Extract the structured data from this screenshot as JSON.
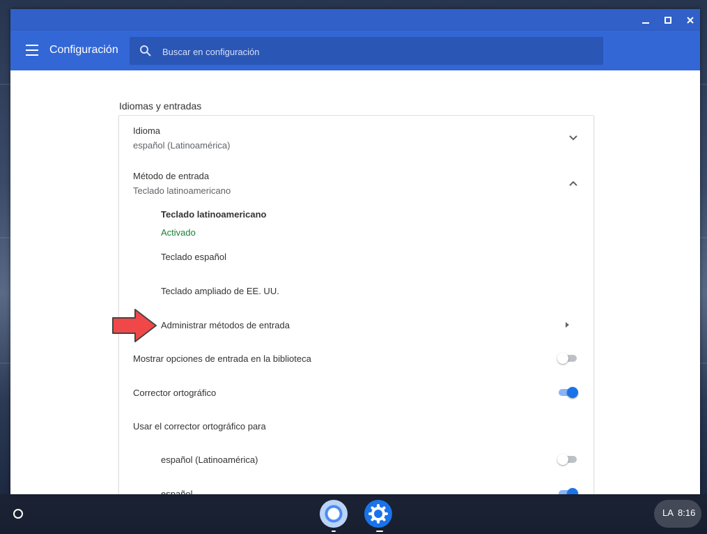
{
  "window": {
    "controls": {
      "minimize_icon": "minimize-icon",
      "maximize_icon": "maximize-icon",
      "close_icon": "close-icon"
    }
  },
  "header": {
    "title": "Configuración",
    "search_placeholder": "Buscar en configuración"
  },
  "section": {
    "title": "Idiomas y entradas"
  },
  "language": {
    "label": "Idioma",
    "value": "español (Latinoamérica)"
  },
  "input_method": {
    "label": "Método de entrada",
    "value": "Teclado latinoamericano",
    "items": [
      {
        "label": "Teclado latinoamericano",
        "status": "Activado"
      },
      {
        "label": "Teclado español"
      },
      {
        "label": "Teclado ampliado de EE. UU."
      }
    ],
    "manage_label": "Administrar métodos de entrada"
  },
  "show_input_options": {
    "label": "Mostrar opciones de entrada en la biblioteca",
    "enabled": false
  },
  "spell_check": {
    "label": "Corrector ortográfico",
    "enabled": true
  },
  "spell_check_for": {
    "label": "Usar el corrector ortográfico para",
    "languages": [
      {
        "label": "español (Latinoamérica)",
        "enabled": false
      },
      {
        "label": "español",
        "enabled": true
      }
    ]
  },
  "shelf": {
    "ime_indicator": "LA",
    "time": "8:16"
  },
  "colors": {
    "accent": "#3367d6",
    "titlebar": "#3060c8",
    "activated_green": "#188038",
    "toggle_on": "#1a73e8"
  }
}
